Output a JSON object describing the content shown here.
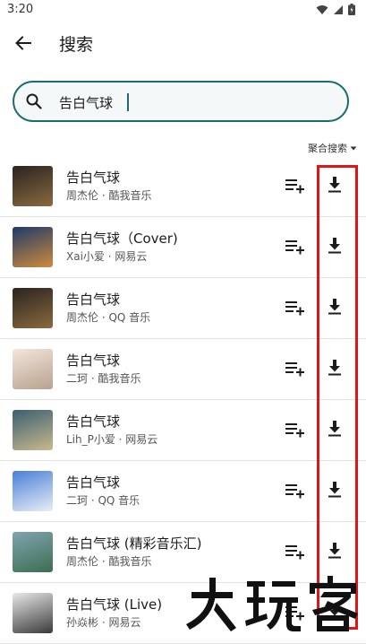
{
  "status_bar": {
    "time": "3:20"
  },
  "header": {
    "title": "搜索"
  },
  "search": {
    "value": "告白气球",
    "placeholder": ""
  },
  "sort": {
    "label": "聚合搜索"
  },
  "colors": {
    "accent": "#1b6b73",
    "highlight": "#e01616"
  },
  "songs": [
    {
      "title": "告白气球",
      "subtitle": "周杰伦 · 酷我音乐",
      "cover": [
        "#2a2320",
        "#8a6a3f"
      ]
    },
    {
      "title": "告白气球（Cover)",
      "subtitle": "Xai小爱 · 网易云",
      "cover": [
        "#1d3a6b",
        "#d08a3c"
      ]
    },
    {
      "title": "告白气球",
      "subtitle": "周杰伦 · QQ 音乐",
      "cover": [
        "#2a2320",
        "#8a6a3f"
      ]
    },
    {
      "title": "告白气球",
      "subtitle": "二珂 · 酷我音乐",
      "cover": [
        "#f3e6dc",
        "#b9a18e"
      ]
    },
    {
      "title": "告白气球",
      "subtitle": "Lih_P小爱 · 网易云",
      "cover": [
        "#3b5f73",
        "#c9b98c"
      ]
    },
    {
      "title": "告白气球",
      "subtitle": "二珂 · QQ 音乐",
      "cover": [
        "#4a7fd6",
        "#e9eef6"
      ]
    },
    {
      "title": "告白气球 (精彩音乐汇)",
      "subtitle": "周杰伦 · 酷我音乐",
      "cover": [
        "#7fa4b0",
        "#3c6e52"
      ]
    },
    {
      "title": "告白气球 (Live)",
      "subtitle": "孙焱彬 · 网易云",
      "cover": [
        "#e8e8e8",
        "#3a3a3a"
      ]
    }
  ],
  "watermark": {
    "text": "大玩家"
  }
}
